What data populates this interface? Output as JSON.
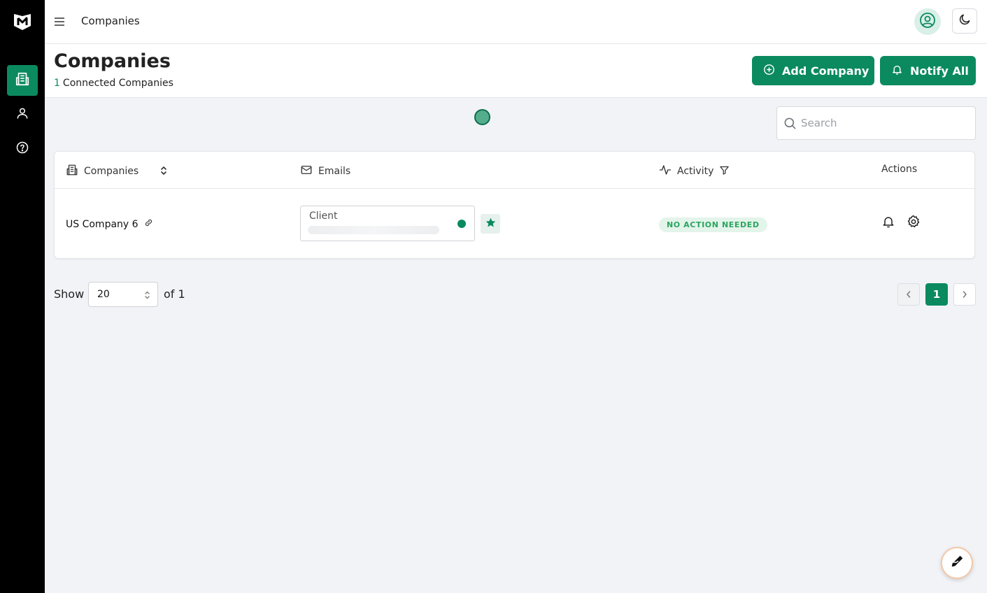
{
  "colors": {
    "accent": "#0b8a5f",
    "sidebar": "#000000",
    "badge_text": "#2aa55f",
    "badge_bg": "#e3f4ea"
  },
  "topbar": {
    "title": "Companies"
  },
  "header": {
    "title": "Companies",
    "connected_count": "1",
    "connected_label": "Connected Companies",
    "add_company_label": "Add Company",
    "notify_all_label": "Notify All"
  },
  "search": {
    "placeholder": "Search"
  },
  "table": {
    "headers": {
      "companies": "Companies",
      "emails": "Emails",
      "activity": "Activity",
      "actions": "Actions"
    },
    "rows": [
      {
        "company": "US Company 6",
        "email_label": "Client",
        "activity": "NO ACTION NEEDED"
      }
    ]
  },
  "pagination": {
    "show_label": "Show",
    "page_size": "20",
    "of_label": "of 1",
    "current_page": "1"
  }
}
